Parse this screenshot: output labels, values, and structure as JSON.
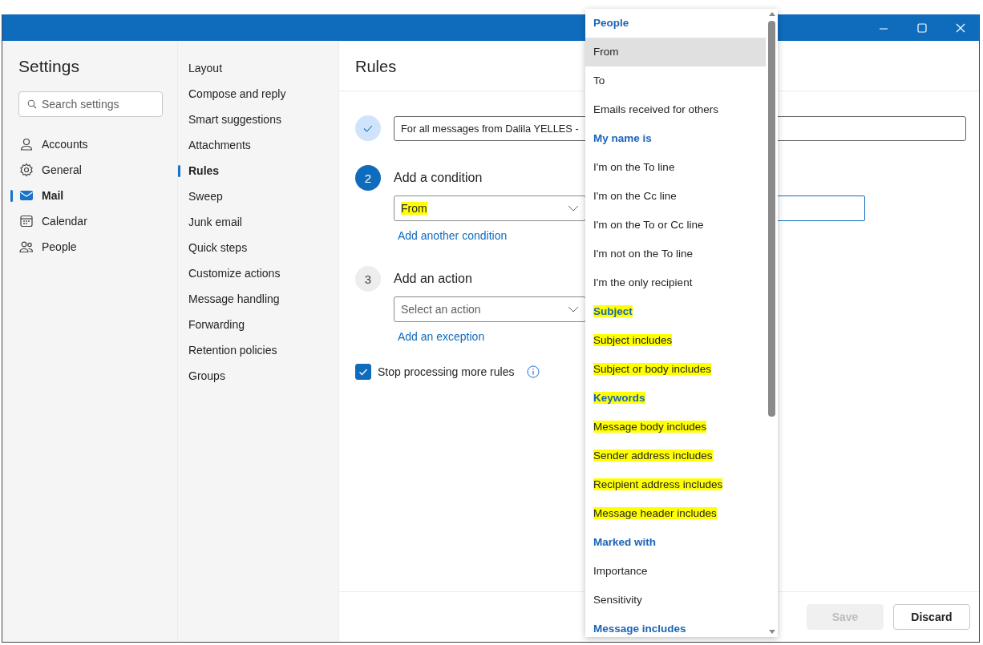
{
  "settings": {
    "title": "Settings",
    "search": {
      "placeholder": "Search settings"
    },
    "categories": [
      {
        "label": "Accounts",
        "selected": false
      },
      {
        "label": "General",
        "selected": false
      },
      {
        "label": "Mail",
        "selected": true
      },
      {
        "label": "Calendar",
        "selected": false
      },
      {
        "label": "People",
        "selected": false
      }
    ]
  },
  "mail_sections": [
    {
      "label": "Layout",
      "selected": false
    },
    {
      "label": "Compose and reply",
      "selected": false
    },
    {
      "label": "Smart suggestions",
      "selected": false
    },
    {
      "label": "Attachments",
      "selected": false
    },
    {
      "label": "Rules",
      "selected": true
    },
    {
      "label": "Sweep",
      "selected": false
    },
    {
      "label": "Junk email",
      "selected": false
    },
    {
      "label": "Quick steps",
      "selected": false
    },
    {
      "label": "Customize actions",
      "selected": false
    },
    {
      "label": "Message handling",
      "selected": false
    },
    {
      "label": "Forwarding",
      "selected": false
    },
    {
      "label": "Retention policies",
      "selected": false
    },
    {
      "label": "Groups",
      "selected": false
    }
  ],
  "rules": {
    "title": "Rules",
    "steps": [
      {
        "completed": true,
        "active": false,
        "name_field": {
          "value": "For all messages from Dalila YELLES -"
        }
      },
      {
        "completed": false,
        "active": true,
        "number": "2",
        "label": "Add a condition",
        "select": {
          "value": "From",
          "highlighted": true
        },
        "value_field": true,
        "link": "Add another condition"
      },
      {
        "completed": false,
        "active": false,
        "number": "3",
        "label": "Add an action",
        "select": {
          "placeholder": "Select an action"
        },
        "link": "Add an exception"
      }
    ],
    "stop_processing": {
      "label": "Stop processing more rules",
      "checked": true
    },
    "buttons": [
      {
        "label": "Save",
        "disabled": true
      },
      {
        "label": "Discard",
        "disabled": false
      }
    ]
  },
  "condition_menu": [
    {
      "kind": "header",
      "label": "People",
      "highlighted": false
    },
    {
      "kind": "option",
      "label": "From",
      "selected": true,
      "highlighted": false
    },
    {
      "kind": "option",
      "label": "To",
      "selected": false,
      "highlighted": false
    },
    {
      "kind": "option",
      "label": "Emails received for others",
      "selected": false,
      "highlighted": false
    },
    {
      "kind": "header",
      "label": "My name is",
      "highlighted": false
    },
    {
      "kind": "option",
      "label": "I'm on the To line",
      "selected": false,
      "highlighted": false
    },
    {
      "kind": "option",
      "label": "I'm on the Cc line",
      "selected": false,
      "highlighted": false
    },
    {
      "kind": "option",
      "label": "I'm on the To or Cc line",
      "selected": false,
      "highlighted": false
    },
    {
      "kind": "option",
      "label": "I'm not on the To line",
      "selected": false,
      "highlighted": false
    },
    {
      "kind": "option",
      "label": "I'm the only recipient",
      "selected": false,
      "highlighted": false
    },
    {
      "kind": "header",
      "label": "Subject",
      "highlighted": true
    },
    {
      "kind": "option",
      "label": "Subject includes",
      "selected": false,
      "highlighted": true
    },
    {
      "kind": "option",
      "label": "Subject or body includes",
      "selected": false,
      "highlighted": true
    },
    {
      "kind": "header",
      "label": "Keywords",
      "highlighted": true
    },
    {
      "kind": "option",
      "label": "Message body includes",
      "selected": false,
      "highlighted": true
    },
    {
      "kind": "option",
      "label": "Sender address includes",
      "selected": false,
      "highlighted": true
    },
    {
      "kind": "option",
      "label": "Recipient address includes",
      "selected": false,
      "highlighted": true
    },
    {
      "kind": "option",
      "label": "Message header includes",
      "selected": false,
      "highlighted": true
    },
    {
      "kind": "header",
      "label": "Marked with",
      "highlighted": false
    },
    {
      "kind": "option",
      "label": "Importance",
      "selected": false,
      "highlighted": false
    },
    {
      "kind": "option",
      "label": "Sensitivity",
      "selected": false,
      "highlighted": false
    },
    {
      "kind": "header",
      "label": "Message includes",
      "highlighted": false
    }
  ]
}
